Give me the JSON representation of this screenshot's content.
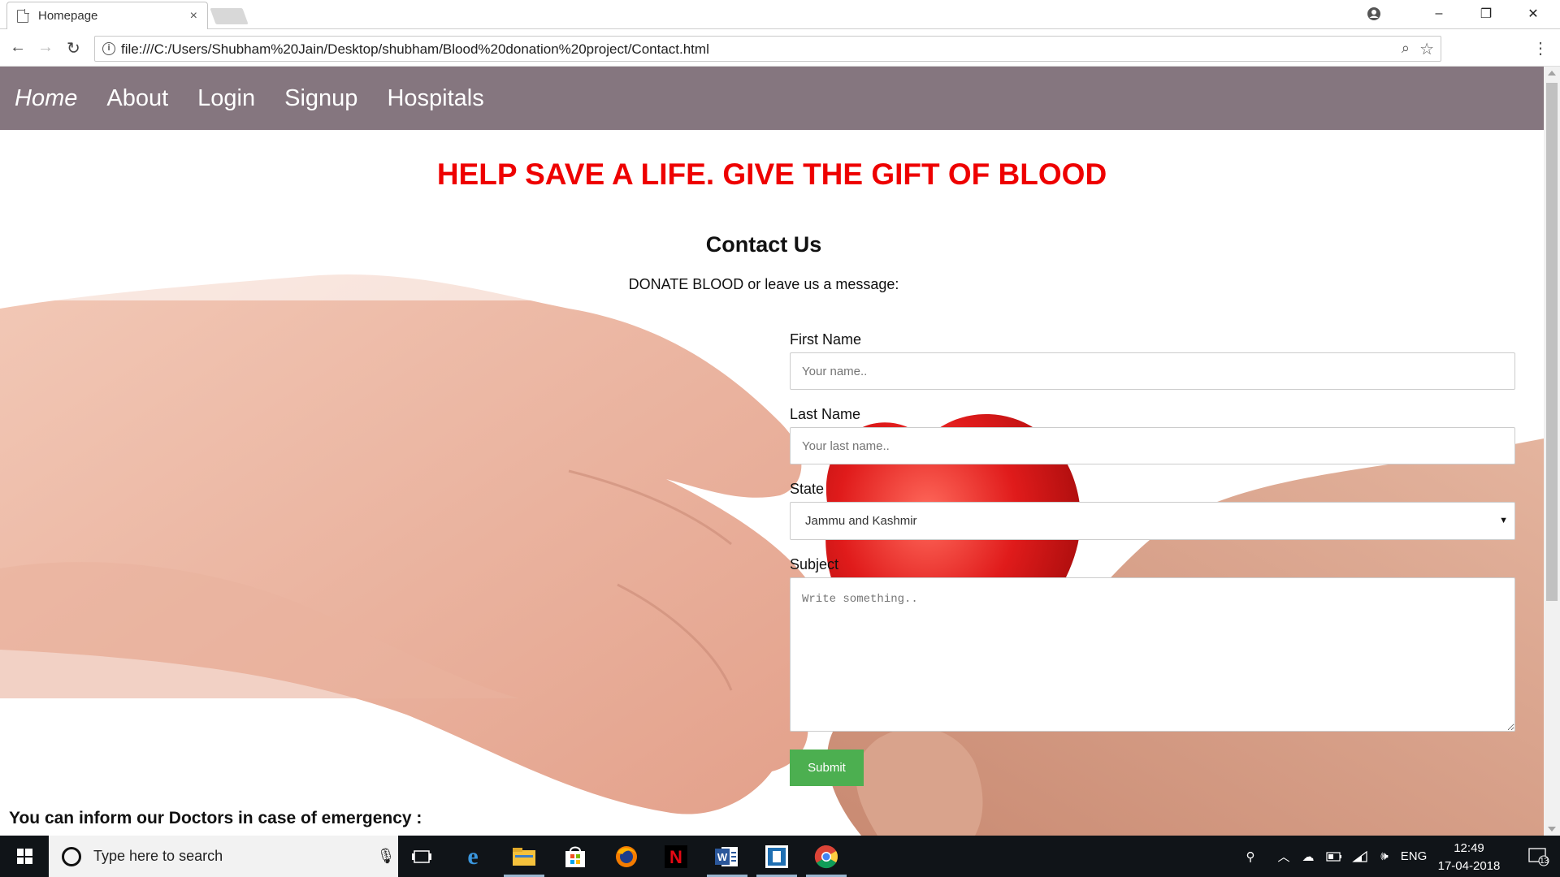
{
  "browser": {
    "tab_title": "Homepage",
    "tab_close": "×",
    "url": "file:///C:/Users/Shubham%20Jain/Desktop/shubham/Blood%20donation%20project/Contact.html",
    "window_controls": {
      "minimize": "–",
      "restore": "❐",
      "close": "✕"
    }
  },
  "site_nav": {
    "items": [
      {
        "label": "Home",
        "active": true
      },
      {
        "label": "About"
      },
      {
        "label": "Login"
      },
      {
        "label": "Signup"
      },
      {
        "label": "Hospitals"
      }
    ],
    "background": "#85767f"
  },
  "page": {
    "headline": "HELP SAVE A LIFE. GIVE THE GIFT OF BLOOD",
    "headline_color": "#ee0000",
    "contact_title": "Contact Us",
    "contact_subtitle": "DONATE BLOOD or leave us a message:",
    "emergency_text": "You can inform our Doctors in case of emergency :"
  },
  "form": {
    "first_name": {
      "label": "First Name",
      "placeholder": "Your name.."
    },
    "last_name": {
      "label": "Last Name",
      "placeholder": "Your last name.."
    },
    "state": {
      "label": "State",
      "selected": "Jammu and Kashmir"
    },
    "subject": {
      "label": "Subject",
      "placeholder": "Write something.."
    },
    "submit_label": "Submit",
    "submit_color": "#4caf50"
  },
  "taskbar": {
    "search_placeholder": "Type here to search",
    "apps": [
      "task-view",
      "edge",
      "file-explorer",
      "store",
      "firefox",
      "netflix",
      "word",
      "app",
      "chrome"
    ],
    "language": "ENG",
    "time": "12:49",
    "date": "17-04-2018",
    "notification_count": "13"
  }
}
